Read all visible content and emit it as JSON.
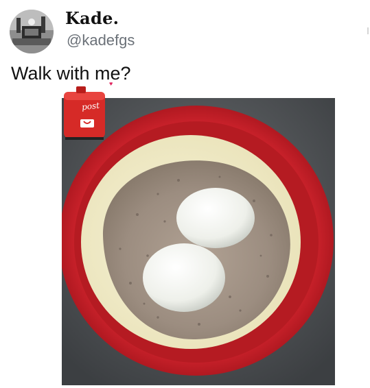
{
  "tweet": {
    "author": {
      "display_name": "Kade.",
      "handle": "@kadefgs",
      "avatar_icon": "profile-photo-avatar"
    },
    "text": "Walk with me?",
    "sticker": {
      "label": "post",
      "icon": "mailbox-sticker-icon"
    },
    "media": {
      "icon": "photo-bowl-oatmeal-eggs"
    }
  },
  "colors": {
    "name": "#111111",
    "handle": "#6b7178",
    "bowl_red": "#c8212a",
    "sticker_red": "#d62a27",
    "heart": "#e0245e"
  }
}
